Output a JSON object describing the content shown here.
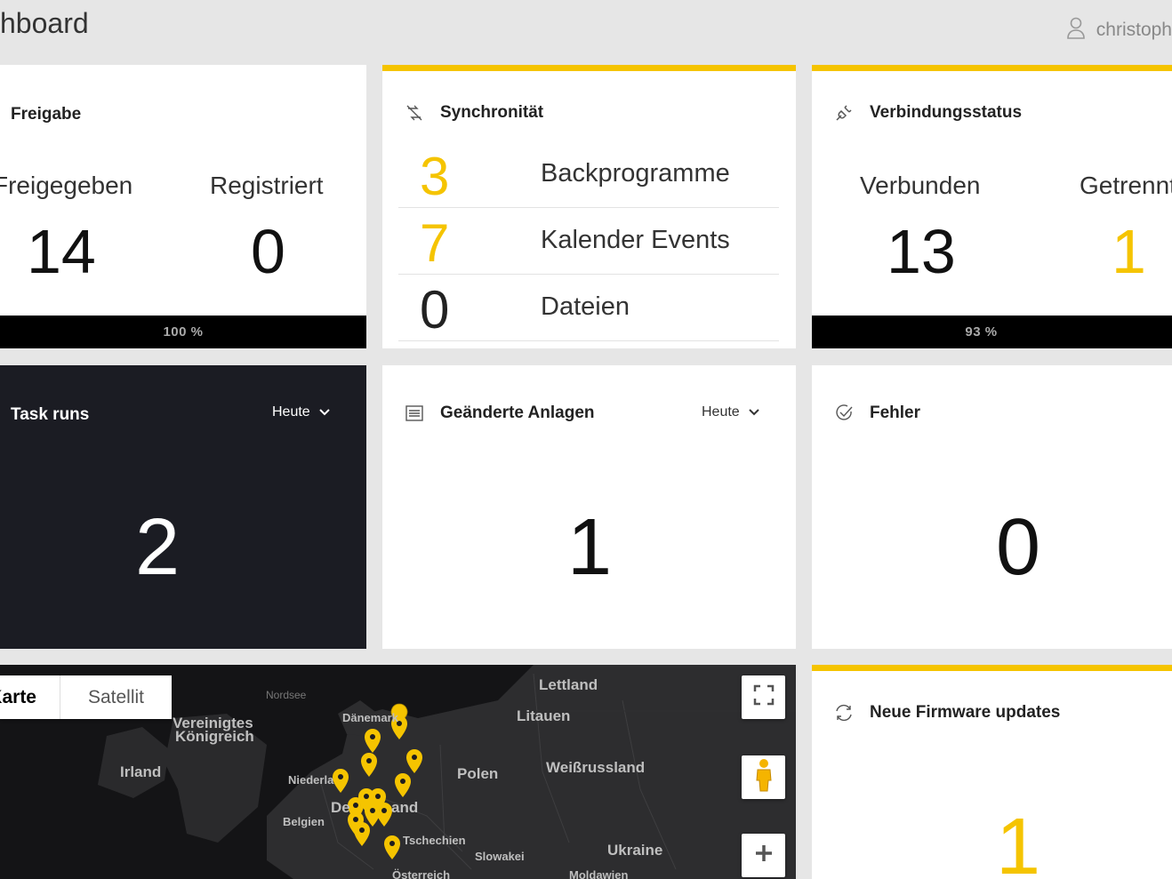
{
  "header": {
    "title": "hboard",
    "user": "christoph"
  },
  "colors": {
    "accent": "#f5c400",
    "dark_card": "#1b1c23",
    "progress_bar": "#000000",
    "background": "#e6e6e6"
  },
  "freigabe": {
    "title": "Freigabe",
    "stat1_label": "Freigegeben",
    "stat1_value": "14",
    "stat2_label": "Registriert",
    "stat2_value": "0",
    "progress_label": "100 %",
    "progress": 1.0
  },
  "synchronitaet": {
    "title": "Synchronität",
    "icon": "sync-off-icon",
    "rows": [
      {
        "value": "3",
        "label": "Backprogramme"
      },
      {
        "value": "7",
        "label": "Kalender Events"
      },
      {
        "value": "0",
        "label": "Dateien"
      }
    ]
  },
  "verbindung": {
    "title": "Verbindungsstatus",
    "icon": "plug-icon",
    "stat1_label": "Verbunden",
    "stat1_value": "13",
    "stat2_label": "Getrennt",
    "stat2_value": "1",
    "progress_label": "93 %",
    "progress": 0.93
  },
  "task_runs": {
    "title": "Task runs",
    "filter": "Heute",
    "value": "2"
  },
  "anlagen": {
    "title": "Geänderte Anlagen",
    "icon": "list-icon",
    "filter": "Heute",
    "value": "1"
  },
  "fehler": {
    "title": "Fehler",
    "icon": "check-circle-icon",
    "value": "0"
  },
  "firmware": {
    "title": "Neue Firmware updates",
    "icon": "refresh-icon",
    "value": "1"
  },
  "map": {
    "toggle_karte": "Karte",
    "toggle_satellit": "Satellit",
    "labels": {
      "nordsee": "Nordsee",
      "lettland": "Lettland",
      "daenemark": "Dänemark",
      "litauen": "Litauen",
      "vereinigtes": "Vereinigtes",
      "koenigreich": "Königreich",
      "irland": "Irland",
      "weissrussland": "Weißrussland",
      "polen": "Polen",
      "niederlande": "Niederla",
      "deutschland_de": "De",
      "deutschland_end": "and",
      "belgien": "Belgien",
      "tschechien": "Tschechien",
      "slowakei": "Slowakei",
      "ukraine": "Ukraine",
      "oesterreich": "Österreich",
      "moldawien": "Moldawien"
    }
  }
}
